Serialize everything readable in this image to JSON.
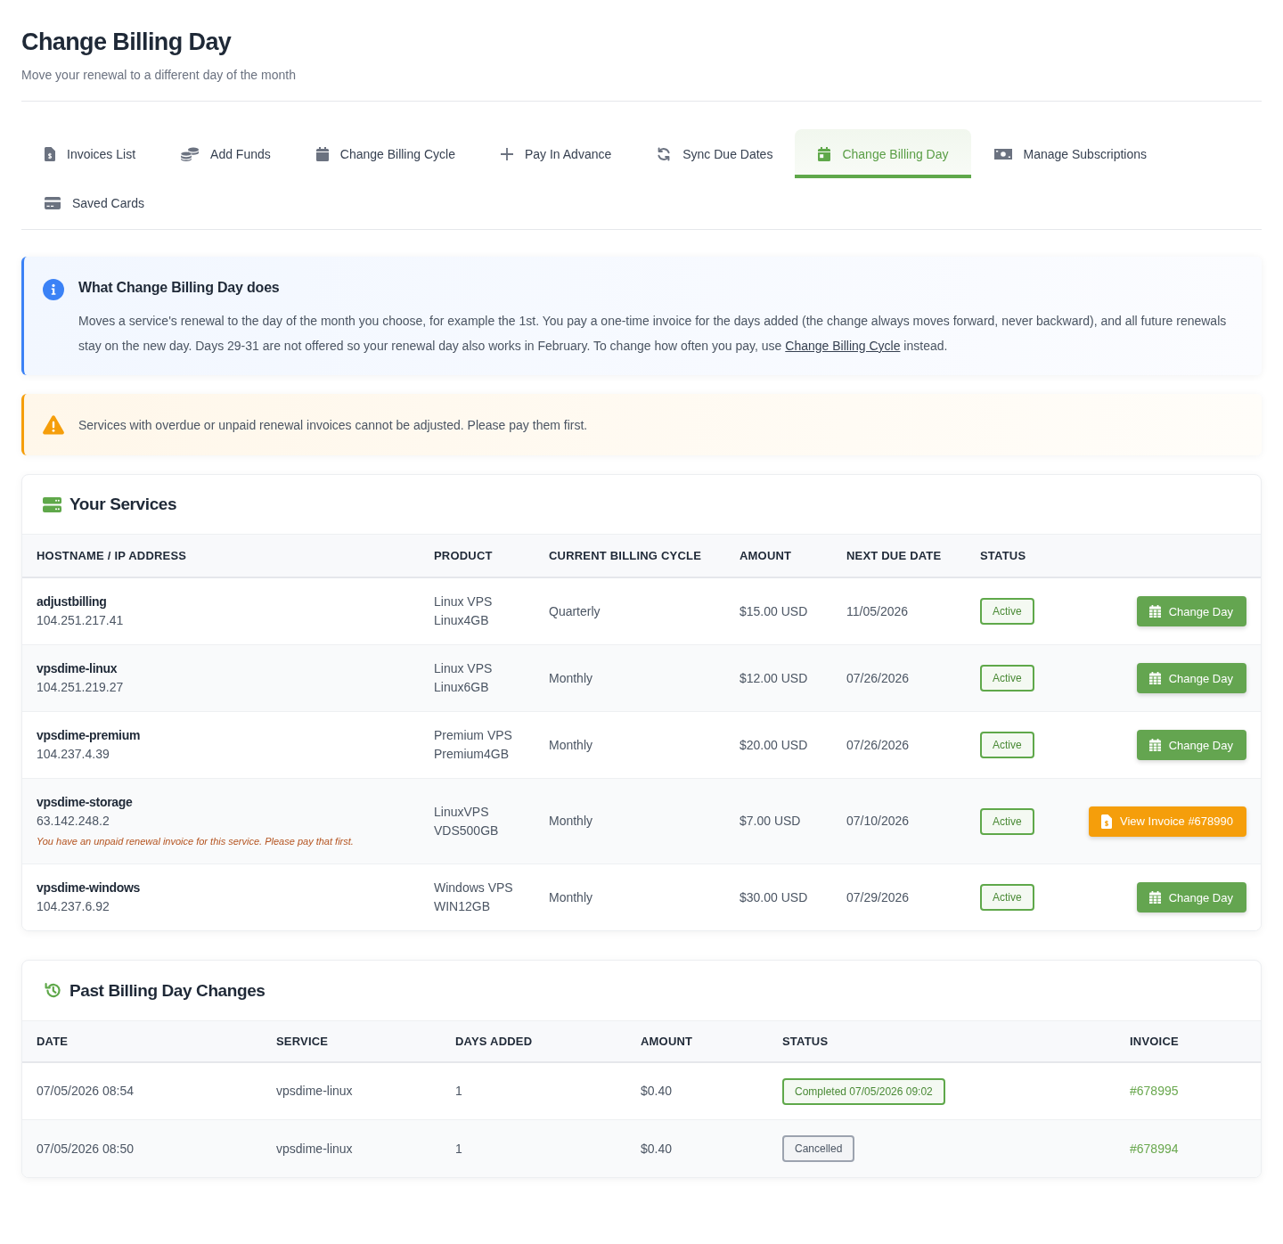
{
  "header": {
    "title": "Change Billing Day",
    "subtitle": "Move your renewal to a different day of the month"
  },
  "tabs": [
    {
      "label": "Invoices List",
      "selected": false
    },
    {
      "label": "Add Funds",
      "selected": false
    },
    {
      "label": "Change Billing Cycle",
      "selected": false
    },
    {
      "label": "Pay In Advance",
      "selected": false
    },
    {
      "label": "Sync Due Dates",
      "selected": false
    },
    {
      "label": "Change Billing Day",
      "selected": true
    },
    {
      "label": "Manage Subscriptions",
      "selected": false
    },
    {
      "label": "Saved Cards",
      "selected": false
    }
  ],
  "info": {
    "title": "What Change Billing Day does",
    "text": "Moves a service's renewal to the day of the month you choose, for example the 1st. You pay a one-time invoice for the days added (the change always moves forward, never backward), and all future renewals stay on the new day. Days 29-31 are not offered so your renewal day also works in February. To change how often you pay, use ",
    "link": "Change Billing Cycle",
    "text_after": " instead."
  },
  "warning": {
    "text": "Services with overdue or unpaid renewal invoices cannot be adjusted. Please pay them first."
  },
  "services": {
    "title": "Your Services",
    "columns": [
      "HOSTNAME / IP ADDRESS",
      "PRODUCT",
      "CURRENT BILLING CYCLE",
      "AMOUNT",
      "NEXT DUE DATE",
      "STATUS"
    ],
    "rows": [
      {
        "hostname": "adjustbilling",
        "ip": "104.251.217.41",
        "product": "Linux VPS",
        "plan": "Linux4GB",
        "cycle": "Quarterly",
        "amount": "$15.00 USD",
        "next_due": "11/05/2026",
        "status": "Active",
        "action": {
          "kind": "change_day",
          "label": "Change Day"
        }
      },
      {
        "hostname": "vpsdime-linux",
        "ip": "104.251.219.27",
        "product": "Linux VPS",
        "plan": "Linux6GB",
        "cycle": "Monthly",
        "amount": "$12.00 USD",
        "next_due": "07/26/2026",
        "status": "Active",
        "action": {
          "kind": "change_day",
          "label": "Change Day"
        }
      },
      {
        "hostname": "vpsdime-premium",
        "ip": "104.237.4.39",
        "product": "Premium VPS",
        "plan": "Premium4GB",
        "cycle": "Monthly",
        "amount": "$20.00 USD",
        "next_due": "07/26/2026",
        "status": "Active",
        "action": {
          "kind": "change_day",
          "label": "Change Day"
        }
      },
      {
        "hostname": "vpsdime-storage",
        "ip": "63.142.248.2",
        "note": "You have an unpaid renewal invoice for this service. Please pay that first.",
        "product": "LinuxVPS",
        "plan": "VDS500GB",
        "cycle": "Monthly",
        "amount": "$7.00 USD",
        "next_due": "07/10/2026",
        "status": "Active",
        "action": {
          "kind": "view_invoice",
          "label": "View Invoice #678990"
        }
      },
      {
        "hostname": "vpsdime-windows",
        "ip": "104.237.6.92",
        "product": "Windows VPS",
        "plan": "WIN12GB",
        "cycle": "Monthly",
        "amount": "$30.00 USD",
        "next_due": "07/29/2026",
        "status": "Active",
        "action": {
          "kind": "change_day",
          "label": "Change Day"
        }
      }
    ]
  },
  "history": {
    "title": "Past Billing Day Changes",
    "columns": [
      "DATE",
      "SERVICE",
      "DAYS ADDED",
      "AMOUNT",
      "STATUS",
      "INVOICE"
    ],
    "rows": [
      {
        "date": "07/05/2026 08:54",
        "service": "vpsdime-linux",
        "days_added": "1",
        "amount": "$0.40",
        "status": {
          "kind": "completed",
          "label": "Completed 07/05/2026 09:02"
        },
        "invoice": "#678995"
      },
      {
        "date": "07/05/2026 08:50",
        "service": "vpsdime-linux",
        "days_added": "1",
        "amount": "$0.40",
        "status": {
          "kind": "cancelled",
          "label": "Cancelled"
        },
        "invoice": "#678994"
      }
    ]
  }
}
